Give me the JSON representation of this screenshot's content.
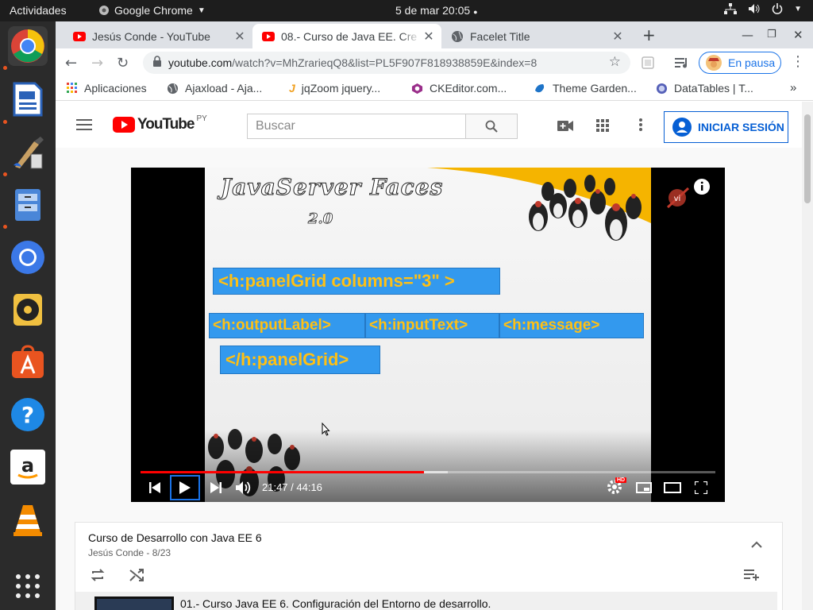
{
  "system": {
    "activities": "Actividades",
    "app_name": "Google Chrome",
    "clock": "5 de mar  20:05"
  },
  "dock": {
    "items": [
      "chrome-icon",
      "document-viewer-icon",
      "paint-icon",
      "file-manager-icon",
      "chromium-icon",
      "audio-player-icon",
      "software-store-icon",
      "help-icon",
      "amazon-icon",
      "vlc-icon",
      "show-apps-icon"
    ]
  },
  "tabs": [
    {
      "title": "Jesús Conde - YouTube"
    },
    {
      "title": "08.- Curso de Java EE. Cre"
    },
    {
      "title": "Facelet Title"
    }
  ],
  "address": {
    "domain": "youtube.com",
    "path": "/watch?v=MhZrarieqQ8&list=PL5F907F818938859E&index=8",
    "profile_label": "En pausa"
  },
  "bookmarks": [
    {
      "label": "Aplicaciones"
    },
    {
      "label": "Ajaxload - Aja..."
    },
    {
      "label": "jqZoom jquery..."
    },
    {
      "label": "CKEditor.com..."
    },
    {
      "label": "Theme Garden..."
    },
    {
      "label": "DataTables | T..."
    }
  ],
  "youtube": {
    "logo_text": "YouTube",
    "country": "PY",
    "search_placeholder": "Buscar",
    "signin_label": "INICIAR SESIÓN"
  },
  "video": {
    "slide_title": "JavaServer Faces",
    "slide_version": "2.0",
    "tags": {
      "panel_open": "<h:panelGrid columns=\"3\" >",
      "output_label": "<h:outputLabel>",
      "input_text": "<h:inputText>",
      "message": "<h:message>",
      "panel_close": "</h:panelGrid>"
    },
    "time": "21:47 / 44:16",
    "progress": 0.493,
    "buffered": 0.535,
    "hd_badge": "HD"
  },
  "playlist": {
    "title": "Curso de Desarrollo con Java EE 6",
    "subtitle": "Jesús Conde - 8/23",
    "first_item": "01.- Curso Java EE 6. Configuración del Entorno de desarrollo."
  },
  "colors": {
    "youtube_red": "#ff0000",
    "link_blue": "#065fd4",
    "slide_tag_bg": "#3399ee",
    "slide_tag_text": "#ffc014"
  }
}
